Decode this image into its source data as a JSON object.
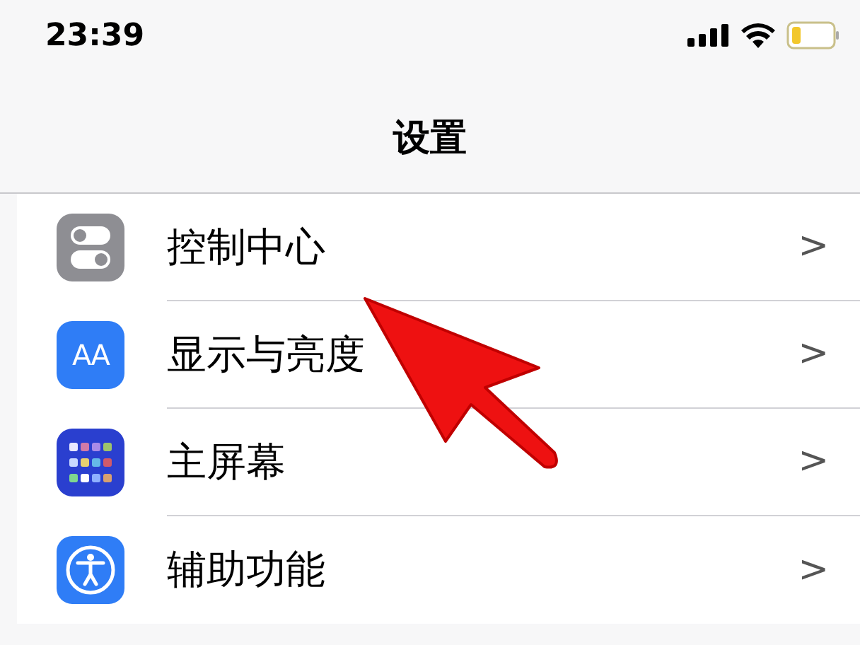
{
  "status_bar": {
    "time": "23:39"
  },
  "title": "设置",
  "items": [
    {
      "kind": "toggles",
      "label": "控制中心",
      "chevron": ">"
    },
    {
      "kind": "text",
      "icon_text": "AA",
      "label": "显示与亮度",
      "chevron": ">"
    },
    {
      "kind": "grid",
      "label": "主屏幕",
      "chevron": ">"
    },
    {
      "kind": "accessibility",
      "label": "辅助功能",
      "chevron": ">"
    }
  ]
}
